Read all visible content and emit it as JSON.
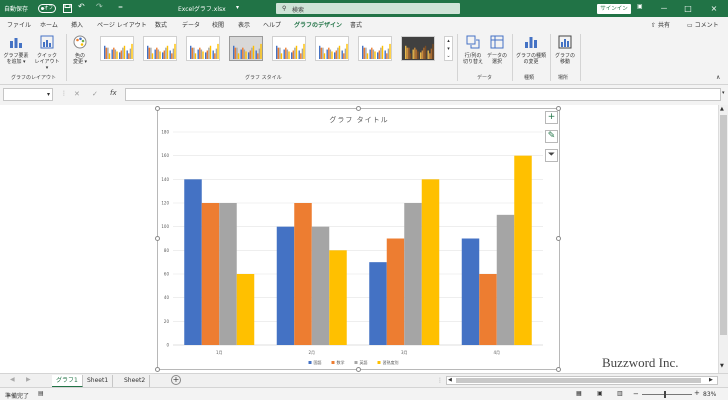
{
  "titlebar": {
    "autosave_label": "自動保存",
    "autosave_state": "オフ",
    "save_icon": "save-icon",
    "undo_icon": "undo-icon",
    "redo_icon": "redo-icon",
    "file_title": "Excelグラフ.xlsx",
    "search_placeholder": "検索",
    "signin_label": "サインイン",
    "controls": [
      "－",
      "□",
      "×"
    ]
  },
  "menu": {
    "tabs": [
      "ファイル",
      "ホーム",
      "挿入",
      "ページ レイアウト",
      "数式",
      "データ",
      "校閲",
      "表示",
      "ヘルプ",
      "グラフのデザイン",
      "書式"
    ],
    "active_tab": "グラフのデザイン",
    "share_label": "共有",
    "comment_label": "コメント"
  },
  "ribbon": {
    "layout_group": {
      "label": "グラフのレイアウト",
      "add_element": [
        "グラフ要素",
        "を追加 ▾"
      ],
      "quick_layout": [
        "クイック",
        "レイアウト ▾"
      ]
    },
    "styles_group": {
      "label": "グラフ スタイル",
      "change_color": [
        "色の",
        "変更 ▾"
      ],
      "thumbnail_count": 8
    },
    "data_group": {
      "label": "データ",
      "switch_row_col": [
        "行/列の",
        "切り替え"
      ],
      "select_data": [
        "データの",
        "選択"
      ]
    },
    "type_group": {
      "label": "種類",
      "change_type": [
        "グラフの種類",
        "の変更"
      ]
    },
    "location_group": {
      "label": "場所",
      "move_chart": [
        "グラフの",
        "移動"
      ]
    }
  },
  "formula_bar": {
    "name_box_value": "",
    "formula_value": ""
  },
  "chart_data": {
    "type": "bar",
    "title": "グラフ タイトル",
    "categories": [
      "1月",
      "2月",
      "3月",
      "4月"
    ],
    "series": [
      {
        "name": "国語",
        "color": "#4472c4",
        "values": [
          140,
          100,
          70,
          90
        ]
      },
      {
        "name": "数学",
        "color": "#ed7d31",
        "values": [
          120,
          120,
          90,
          60
        ]
      },
      {
        "name": "英語",
        "color": "#a5a5a5",
        "values": [
          120,
          100,
          120,
          110
        ]
      },
      {
        "name": "習熟度別",
        "color": "#ffc000",
        "values": [
          60,
          80,
          140,
          160
        ]
      }
    ],
    "ylim": [
      0,
      180
    ],
    "yticks": [
      0,
      20,
      40,
      60,
      80,
      100,
      120,
      140,
      160,
      180
    ],
    "grid": true,
    "legend": "bottom"
  },
  "sheet_tabs": {
    "tabs": [
      "グラフ1",
      "Sheet1",
      "Sheet2"
    ],
    "active": "グラフ1",
    "add_icon": "plus-icon"
  },
  "statusbar": {
    "ready_text": "準備完了",
    "zoom": "83%"
  },
  "watermark": "Buzzword Inc."
}
